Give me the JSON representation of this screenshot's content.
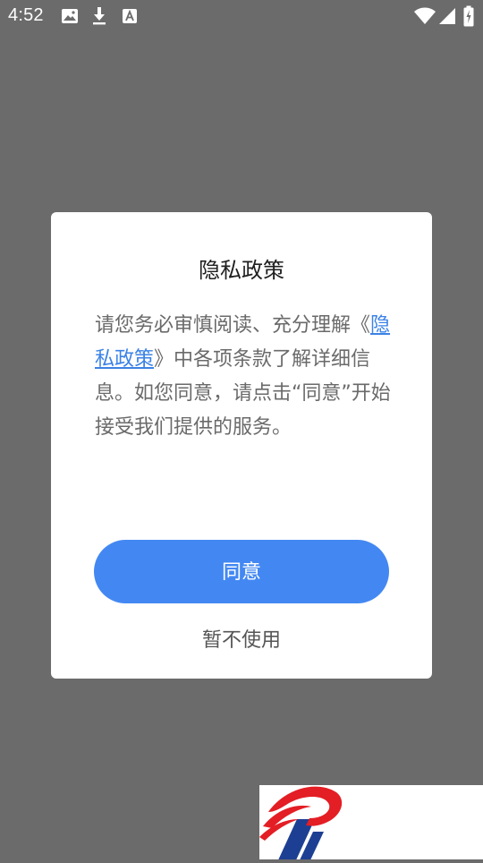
{
  "status_bar": {
    "time": "4:52",
    "left_icons": [
      "image-icon",
      "download-icon",
      "text-icon"
    ],
    "right_icons": [
      "wifi-icon",
      "cellular-icon",
      "battery-icon"
    ]
  },
  "dialog": {
    "title": "隐私政策",
    "body_before_link": "请您务必审慎阅读、充分理解《",
    "link_text": "隐私政策",
    "body_after_link": "》中各项条款了解详细信息。如您同意，请点击“同意”开始接受我们提供的服务。",
    "agree_label": "同意",
    "decline_label": "暂不使用"
  },
  "colors": {
    "overlay": "#6b6b6b",
    "primary": "#4388f2",
    "link": "#3b82e6",
    "logo_red": "#e31e24",
    "logo_blue": "#1d3f93"
  }
}
